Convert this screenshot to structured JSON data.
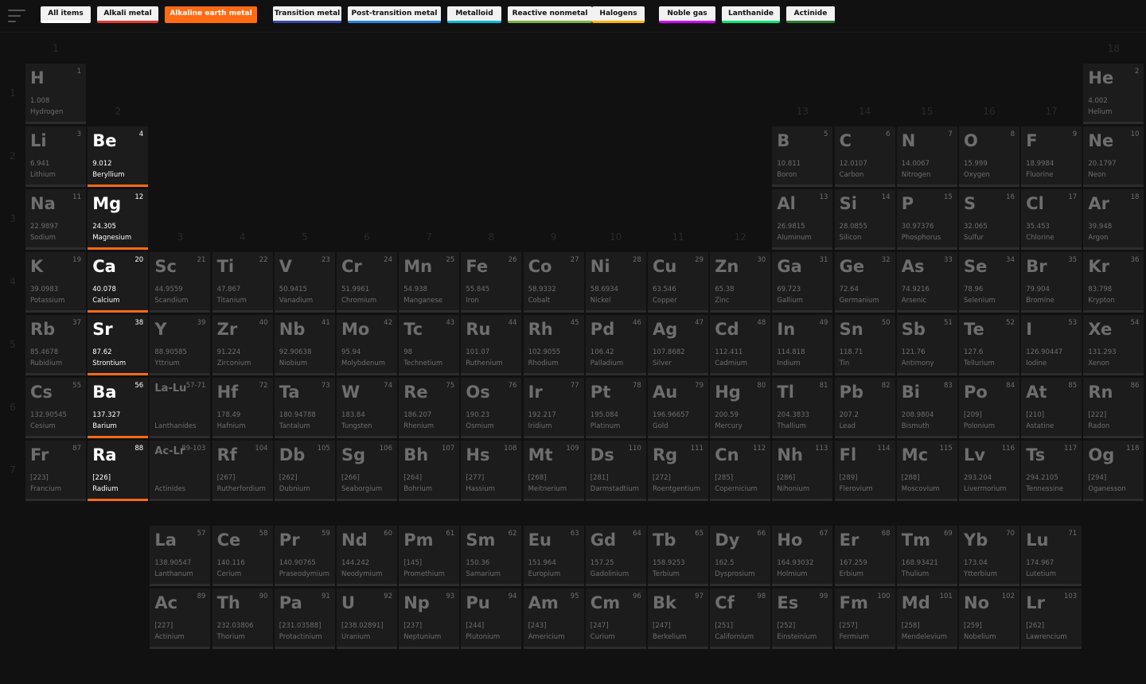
{
  "filters": [
    {
      "label": "All items",
      "color": "#ffffff",
      "active": false
    },
    {
      "label": "Alkali metal",
      "color": "#e53935",
      "active": false
    },
    {
      "label": "Alkaline earth metal",
      "color": "#ff6a13",
      "active": true
    },
    {
      "label": "Transition metal",
      "color": "#3949ab",
      "active": false
    },
    {
      "label": "Post-transition metal",
      "color": "#1e88e5",
      "active": false
    },
    {
      "label": "Metalloid",
      "color": "#00bcd4",
      "active": false
    },
    {
      "label": "Reactive nonmetal",
      "color": "#7cb342",
      "active": false
    },
    {
      "label": "Halogens",
      "color": "#ffb300",
      "active": false
    },
    {
      "label": "Noble gas",
      "color": "#d500f9",
      "active": false
    },
    {
      "label": "Lanthanide",
      "color": "#00e676",
      "active": false
    },
    {
      "label": "Actinide",
      "color": "#2e7d32",
      "active": false
    }
  ],
  "group_labels": [
    "1",
    "2",
    "3",
    "4",
    "5",
    "6",
    "7",
    "8",
    "9",
    "10",
    "11",
    "12",
    "13",
    "14",
    "15",
    "16",
    "17",
    "18"
  ],
  "period_labels": [
    "1",
    "2",
    "3",
    "4",
    "5",
    "6",
    "7"
  ],
  "elements": [
    {
      "s": "H",
      "n": "1",
      "m": "1.008",
      "name": "Hydrogen",
      "g": 1,
      "p": 1
    },
    {
      "s": "He",
      "n": "2",
      "m": "4.002",
      "name": "Helium",
      "g": 18,
      "p": 1
    },
    {
      "s": "Li",
      "n": "3",
      "m": "6.941",
      "name": "Lithium",
      "g": 1,
      "p": 2
    },
    {
      "s": "Be",
      "n": "4",
      "m": "9.012",
      "name": "Beryllium",
      "g": 2,
      "p": 2,
      "active": true
    },
    {
      "s": "B",
      "n": "5",
      "m": "10.811",
      "name": "Boron",
      "g": 13,
      "p": 2
    },
    {
      "s": "C",
      "n": "6",
      "m": "12.0107",
      "name": "Carbon",
      "g": 14,
      "p": 2
    },
    {
      "s": "N",
      "n": "7",
      "m": "14.0067",
      "name": "Nitrogen",
      "g": 15,
      "p": 2
    },
    {
      "s": "O",
      "n": "8",
      "m": "15.999",
      "name": "Oxygen",
      "g": 16,
      "p": 2
    },
    {
      "s": "F",
      "n": "9",
      "m": "18.9984",
      "name": "Fluorine",
      "g": 17,
      "p": 2
    },
    {
      "s": "Ne",
      "n": "10",
      "m": "20.1797",
      "name": "Neon",
      "g": 18,
      "p": 2
    },
    {
      "s": "Na",
      "n": "11",
      "m": "22.9897",
      "name": "Sodium",
      "g": 1,
      "p": 3
    },
    {
      "s": "Mg",
      "n": "12",
      "m": "24.305",
      "name": "Magnesium",
      "g": 2,
      "p": 3,
      "active": true
    },
    {
      "s": "Al",
      "n": "13",
      "m": "26.9815",
      "name": "Aluminum",
      "g": 13,
      "p": 3
    },
    {
      "s": "Si",
      "n": "14",
      "m": "28.0855",
      "name": "Silicon",
      "g": 14,
      "p": 3
    },
    {
      "s": "P",
      "n": "15",
      "m": "30.97376",
      "name": "Phosphorus",
      "g": 15,
      "p": 3
    },
    {
      "s": "S",
      "n": "16",
      "m": "32.065",
      "name": "Sulfur",
      "g": 16,
      "p": 3
    },
    {
      "s": "Cl",
      "n": "17",
      "m": "35.453",
      "name": "Chlorine",
      "g": 17,
      "p": 3
    },
    {
      "s": "Ar",
      "n": "18",
      "m": "39.948",
      "name": "Argon",
      "g": 18,
      "p": 3
    },
    {
      "s": "K",
      "n": "19",
      "m": "39.0983",
      "name": "Potassium",
      "g": 1,
      "p": 4
    },
    {
      "s": "Ca",
      "n": "20",
      "m": "40.078",
      "name": "Calcium",
      "g": 2,
      "p": 4,
      "active": true
    },
    {
      "s": "Sc",
      "n": "21",
      "m": "44.9559",
      "name": "Scandium",
      "g": 3,
      "p": 4
    },
    {
      "s": "Ti",
      "n": "22",
      "m": "47.867",
      "name": "Titanium",
      "g": 4,
      "p": 4
    },
    {
      "s": "V",
      "n": "23",
      "m": "50.9415",
      "name": "Vanadium",
      "g": 5,
      "p": 4
    },
    {
      "s": "Cr",
      "n": "24",
      "m": "51.9961",
      "name": "Chromium",
      "g": 6,
      "p": 4
    },
    {
      "s": "Mn",
      "n": "25",
      "m": "54.938",
      "name": "Manganese",
      "g": 7,
      "p": 4
    },
    {
      "s": "Fe",
      "n": "26",
      "m": "55.845",
      "name": "Iron",
      "g": 8,
      "p": 4
    },
    {
      "s": "Co",
      "n": "27",
      "m": "58.9332",
      "name": "Cobalt",
      "g": 9,
      "p": 4
    },
    {
      "s": "Ni",
      "n": "28",
      "m": "58.6934",
      "name": "Nickel",
      "g": 10,
      "p": 4
    },
    {
      "s": "Cu",
      "n": "29",
      "m": "63.546",
      "name": "Copper",
      "g": 11,
      "p": 4
    },
    {
      "s": "Zn",
      "n": "30",
      "m": "65.38",
      "name": "Zinc",
      "g": 12,
      "p": 4
    },
    {
      "s": "Ga",
      "n": "31",
      "m": "69.723",
      "name": "Gallium",
      "g": 13,
      "p": 4
    },
    {
      "s": "Ge",
      "n": "32",
      "m": "72.64",
      "name": "Germanium",
      "g": 14,
      "p": 4
    },
    {
      "s": "As",
      "n": "33",
      "m": "74.9216",
      "name": "Arsenic",
      "g": 15,
      "p": 4
    },
    {
      "s": "Se",
      "n": "34",
      "m": "78.96",
      "name": "Selenium",
      "g": 16,
      "p": 4
    },
    {
      "s": "Br",
      "n": "35",
      "m": "79.904",
      "name": "Bromine",
      "g": 17,
      "p": 4
    },
    {
      "s": "Kr",
      "n": "36",
      "m": "83.798",
      "name": "Krypton",
      "g": 18,
      "p": 4
    },
    {
      "s": "Rb",
      "n": "37",
      "m": "85.4678",
      "name": "Rubidium",
      "g": 1,
      "p": 5
    },
    {
      "s": "Sr",
      "n": "38",
      "m": "87.62",
      "name": "Strontium",
      "g": 2,
      "p": 5,
      "active": true
    },
    {
      "s": "Y",
      "n": "39",
      "m": "88.90585",
      "name": "Yttrium",
      "g": 3,
      "p": 5
    },
    {
      "s": "Zr",
      "n": "40",
      "m": "91.224",
      "name": "Zirconium",
      "g": 4,
      "p": 5
    },
    {
      "s": "Nb",
      "n": "41",
      "m": "92.90638",
      "name": "Niobium",
      "g": 5,
      "p": 5
    },
    {
      "s": "Mo",
      "n": "42",
      "m": "95.94",
      "name": "Molybdenum",
      "g": 6,
      "p": 5
    },
    {
      "s": "Tc",
      "n": "43",
      "m": "98",
      "name": "Technetium",
      "g": 7,
      "p": 5
    },
    {
      "s": "Ru",
      "n": "44",
      "m": "101.07",
      "name": "Ruthenium",
      "g": 8,
      "p": 5
    },
    {
      "s": "Rh",
      "n": "45",
      "m": "102.9055",
      "name": "Rhodium",
      "g": 9,
      "p": 5
    },
    {
      "s": "Pd",
      "n": "46",
      "m": "106.42",
      "name": "Palladium",
      "g": 10,
      "p": 5
    },
    {
      "s": "Ag",
      "n": "47",
      "m": "107.8682",
      "name": "Silver",
      "g": 11,
      "p": 5
    },
    {
      "s": "Cd",
      "n": "48",
      "m": "112.411",
      "name": "Cadmium",
      "g": 12,
      "p": 5
    },
    {
      "s": "In",
      "n": "49",
      "m": "114.818",
      "name": "Indium",
      "g": 13,
      "p": 5
    },
    {
      "s": "Sn",
      "n": "50",
      "m": "118.71",
      "name": "Tin",
      "g": 14,
      "p": 5
    },
    {
      "s": "Sb",
      "n": "51",
      "m": "121.76",
      "name": "Antimony",
      "g": 15,
      "p": 5
    },
    {
      "s": "Te",
      "n": "52",
      "m": "127.6",
      "name": "Tellurium",
      "g": 16,
      "p": 5
    },
    {
      "s": "I",
      "n": "53",
      "m": "126.90447",
      "name": "Iodine",
      "g": 17,
      "p": 5
    },
    {
      "s": "Xe",
      "n": "54",
      "m": "131.293",
      "name": "Xenon",
      "g": 18,
      "p": 5
    },
    {
      "s": "Cs",
      "n": "55",
      "m": "132.90545",
      "name": "Cesium",
      "g": 1,
      "p": 6
    },
    {
      "s": "Ba",
      "n": "56",
      "m": "137.327",
      "name": "Barium",
      "g": 2,
      "p": 6,
      "active": true
    },
    {
      "s": "La-Lu",
      "n": "57-71",
      "m": "",
      "name": "Lanthanides",
      "g": 3,
      "p": 6,
      "placeholder": true
    },
    {
      "s": "Hf",
      "n": "72",
      "m": "178.49",
      "name": "Hafnium",
      "g": 4,
      "p": 6
    },
    {
      "s": "Ta",
      "n": "73",
      "m": "180.94788",
      "name": "Tantalum",
      "g": 5,
      "p": 6
    },
    {
      "s": "W",
      "n": "74",
      "m": "183.84",
      "name": "Tungsten",
      "g": 6,
      "p": 6
    },
    {
      "s": "Re",
      "n": "75",
      "m": "186.207",
      "name": "Rhenium",
      "g": 7,
      "p": 6
    },
    {
      "s": "Os",
      "n": "76",
      "m": "190.23",
      "name": "Osmium",
      "g": 8,
      "p": 6
    },
    {
      "s": "Ir",
      "n": "77",
      "m": "192.217",
      "name": "Iridium",
      "g": 9,
      "p": 6
    },
    {
      "s": "Pt",
      "n": "78",
      "m": "195.084",
      "name": "Platinum",
      "g": 10,
      "p": 6
    },
    {
      "s": "Au",
      "n": "79",
      "m": "196.96657",
      "name": "Gold",
      "g": 11,
      "p": 6
    },
    {
      "s": "Hg",
      "n": "80",
      "m": "200.59",
      "name": "Mercury",
      "g": 12,
      "p": 6
    },
    {
      "s": "Tl",
      "n": "81",
      "m": "204.3833",
      "name": "Thallium",
      "g": 13,
      "p": 6
    },
    {
      "s": "Pb",
      "n": "82",
      "m": "207.2",
      "name": "Lead",
      "g": 14,
      "p": 6
    },
    {
      "s": "Bi",
      "n": "83",
      "m": "208.9804",
      "name": "Bismuth",
      "g": 15,
      "p": 6
    },
    {
      "s": "Po",
      "n": "84",
      "m": "[209]",
      "name": "Polonium",
      "g": 16,
      "p": 6
    },
    {
      "s": "At",
      "n": "85",
      "m": "[210]",
      "name": "Astatine",
      "g": 17,
      "p": 6
    },
    {
      "s": "Rn",
      "n": "86",
      "m": "[222]",
      "name": "Radon",
      "g": 18,
      "p": 6
    },
    {
      "s": "Fr",
      "n": "87",
      "m": "[223]",
      "name": "Francium",
      "g": 1,
      "p": 7
    },
    {
      "s": "Ra",
      "n": "88",
      "m": "[226]",
      "name": "Radium",
      "g": 2,
      "p": 7,
      "active": true
    },
    {
      "s": "Ac-Lr",
      "n": "89-103",
      "m": "",
      "name": "Actinides",
      "g": 3,
      "p": 7,
      "placeholder": true
    },
    {
      "s": "Rf",
      "n": "104",
      "m": "[267]",
      "name": "Rutherfordium",
      "g": 4,
      "p": 7
    },
    {
      "s": "Db",
      "n": "105",
      "m": "[262]",
      "name": "Dubnium",
      "g": 5,
      "p": 7
    },
    {
      "s": "Sg",
      "n": "106",
      "m": "[266]",
      "name": "Seaborgium",
      "g": 6,
      "p": 7
    },
    {
      "s": "Bh",
      "n": "107",
      "m": "[264]",
      "name": "Bohrium",
      "g": 7,
      "p": 7
    },
    {
      "s": "Hs",
      "n": "108",
      "m": "[277]",
      "name": "Hassium",
      "g": 8,
      "p": 7
    },
    {
      "s": "Mt",
      "n": "109",
      "m": "[268]",
      "name": "Meitnerium",
      "g": 9,
      "p": 7
    },
    {
      "s": "Ds",
      "n": "110",
      "m": "[281]",
      "name": "Darmstadtium",
      "g": 10,
      "p": 7
    },
    {
      "s": "Rg",
      "n": "111",
      "m": "[272]",
      "name": "Roentgentium",
      "g": 11,
      "p": 7
    },
    {
      "s": "Cn",
      "n": "112",
      "m": "[285]",
      "name": "Copernicium",
      "g": 12,
      "p": 7
    },
    {
      "s": "Nh",
      "n": "113",
      "m": "[286]",
      "name": "Nihonium",
      "g": 13,
      "p": 7
    },
    {
      "s": "Fl",
      "n": "114",
      "m": "[289]",
      "name": "Flerovium",
      "g": 14,
      "p": 7
    },
    {
      "s": "Mc",
      "n": "115",
      "m": "[288]",
      "name": "Moscovium",
      "g": 15,
      "p": 7
    },
    {
      "s": "Lv",
      "n": "116",
      "m": "293.204",
      "name": "Livermorium",
      "g": 16,
      "p": 7
    },
    {
      "s": "Ts",
      "n": "117",
      "m": "294.2105",
      "name": "Tennessine",
      "g": 17,
      "p": 7
    },
    {
      "s": "Og",
      "n": "118",
      "m": "[294]",
      "name": "Oganesson",
      "g": 18,
      "p": 7
    },
    {
      "s": "La",
      "n": "57",
      "m": "138.90547",
      "name": "Lanthanum",
      "g": 3,
      "p": 8
    },
    {
      "s": "Ce",
      "n": "58",
      "m": "140.116",
      "name": "Cerium",
      "g": 4,
      "p": 8
    },
    {
      "s": "Pr",
      "n": "59",
      "m": "140.90765",
      "name": "Praseodymium",
      "g": 5,
      "p": 8
    },
    {
      "s": "Nd",
      "n": "60",
      "m": "144.242",
      "name": "Neodymium",
      "g": 6,
      "p": 8
    },
    {
      "s": "Pm",
      "n": "61",
      "m": "[145]",
      "name": "Promethium",
      "g": 7,
      "p": 8
    },
    {
      "s": "Sm",
      "n": "62",
      "m": "150.36",
      "name": "Samarium",
      "g": 8,
      "p": 8
    },
    {
      "s": "Eu",
      "n": "63",
      "m": "151.964",
      "name": "Europium",
      "g": 9,
      "p": 8
    },
    {
      "s": "Gd",
      "n": "64",
      "m": "157.25",
      "name": "Gadolinium",
      "g": 10,
      "p": 8
    },
    {
      "s": "Tb",
      "n": "65",
      "m": "158.9253",
      "name": "Terbium",
      "g": 11,
      "p": 8
    },
    {
      "s": "Dy",
      "n": "66",
      "m": "162.5",
      "name": "Dysprosium",
      "g": 12,
      "p": 8
    },
    {
      "s": "Ho",
      "n": "67",
      "m": "164.93032",
      "name": "Holmium",
      "g": 13,
      "p": 8
    },
    {
      "s": "Er",
      "n": "68",
      "m": "167.259",
      "name": "Erbium",
      "g": 14,
      "p": 8
    },
    {
      "s": "Tm",
      "n": "69",
      "m": "168.93421",
      "name": "Thulium",
      "g": 15,
      "p": 8
    },
    {
      "s": "Yb",
      "n": "70",
      "m": "173.04",
      "name": "Ytterbium",
      "g": 16,
      "p": 8
    },
    {
      "s": "Lu",
      "n": "71",
      "m": "174.967",
      "name": "Lutetium",
      "g": 17,
      "p": 8
    },
    {
      "s": "Ac",
      "n": "89",
      "m": "[227]",
      "name": "Actinium",
      "g": 3,
      "p": 9
    },
    {
      "s": "Th",
      "n": "90",
      "m": "232.03806",
      "name": "Thorium",
      "g": 4,
      "p": 9
    },
    {
      "s": "Pa",
      "n": "91",
      "m": "[231.03588]",
      "name": "Protactinium",
      "g": 5,
      "p": 9
    },
    {
      "s": "U",
      "n": "92",
      "m": "[238.02891]",
      "name": "Uranium",
      "g": 6,
      "p": 9
    },
    {
      "s": "Np",
      "n": "93",
      "m": "[237]",
      "name": "Neptunium",
      "g": 7,
      "p": 9
    },
    {
      "s": "Pu",
      "n": "94",
      "m": "[244]",
      "name": "Plutonium",
      "g": 8,
      "p": 9
    },
    {
      "s": "Am",
      "n": "95",
      "m": "[243]",
      "name": "Americium",
      "g": 9,
      "p": 9
    },
    {
      "s": "Cm",
      "n": "96",
      "m": "[247]",
      "name": "Curium",
      "g": 10,
      "p": 9
    },
    {
      "s": "Bk",
      "n": "97",
      "m": "[247]",
      "name": "Berkelium",
      "g": 11,
      "p": 9
    },
    {
      "s": "Cf",
      "n": "98",
      "m": "[251]",
      "name": "Californium",
      "g": 12,
      "p": 9
    },
    {
      "s": "Es",
      "n": "99",
      "m": "[252]",
      "name": "Einsteinium",
      "g": 13,
      "p": 9
    },
    {
      "s": "Fm",
      "n": "100",
      "m": "[257]",
      "name": "Fermium",
      "g": 14,
      "p": 9
    },
    {
      "s": "Md",
      "n": "101",
      "m": "[258]",
      "name": "Mendelevium",
      "g": 15,
      "p": 9
    },
    {
      "s": "No",
      "n": "102",
      "m": "[259]",
      "name": "Nobelium",
      "g": 16,
      "p": 9
    },
    {
      "s": "Lr",
      "n": "103",
      "m": "[262]",
      "name": "Lawrencium",
      "g": 17,
      "p": 9
    }
  ]
}
